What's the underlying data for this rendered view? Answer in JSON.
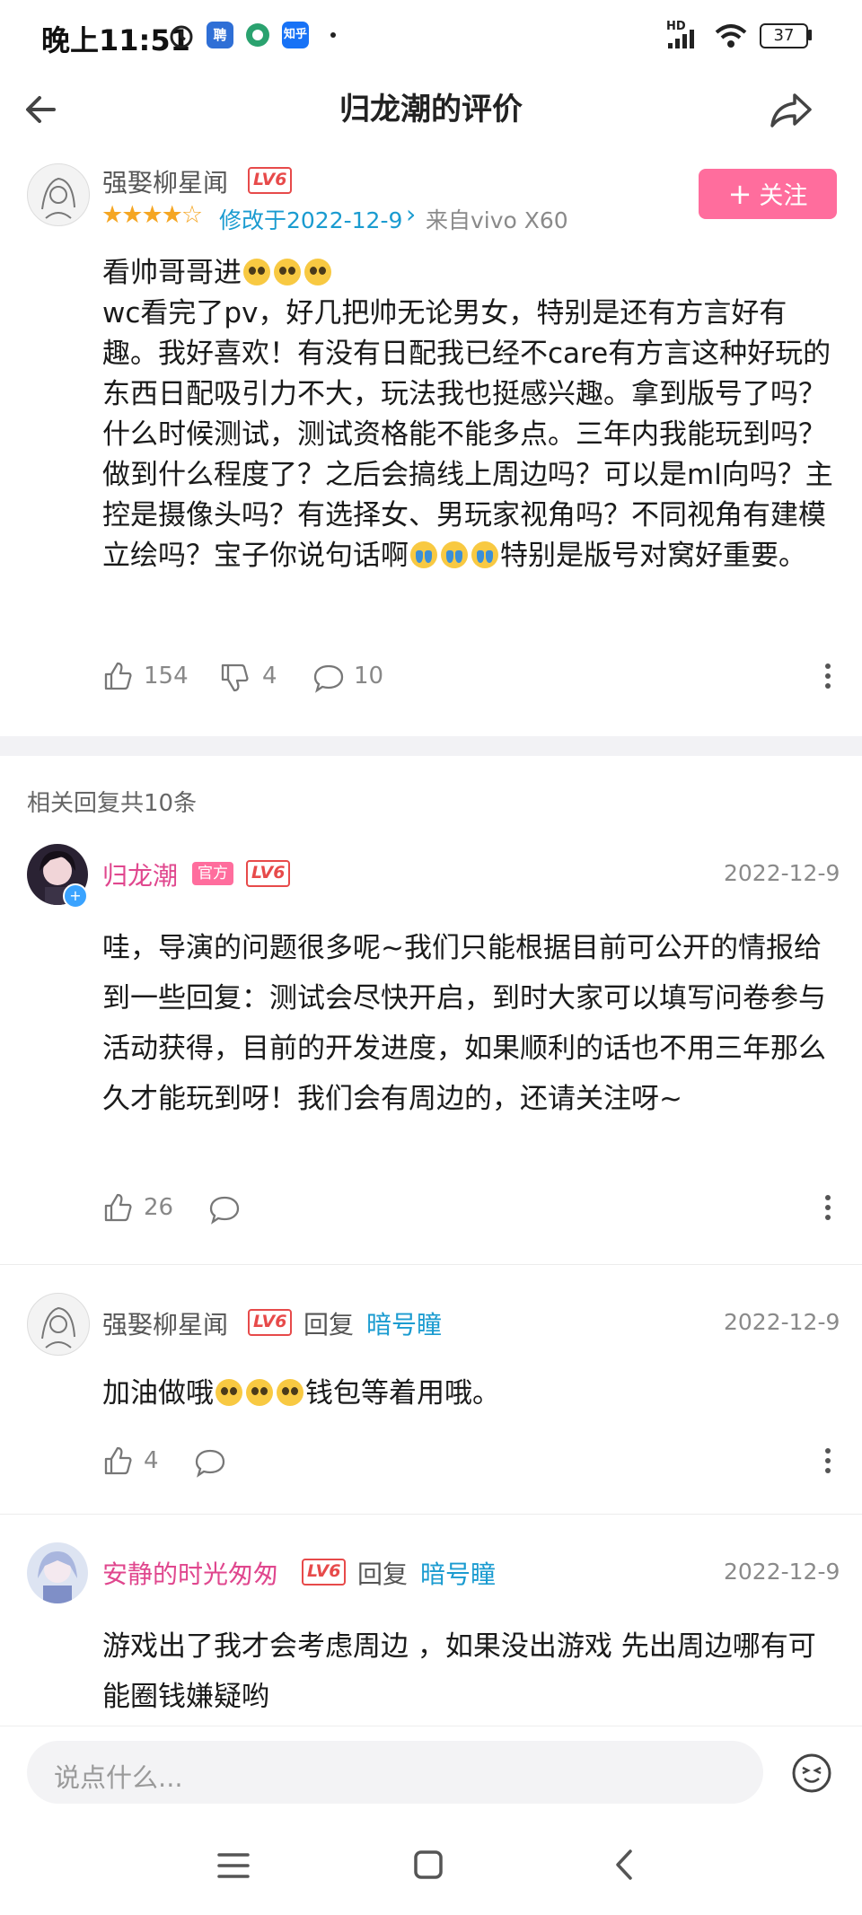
{
  "status_bar": {
    "time": "晚上11:51",
    "apps": [
      "聘",
      "知乎"
    ],
    "network": "HD",
    "battery": "37"
  },
  "header": {
    "title": "归龙潮的评价"
  },
  "review": {
    "author": "强娶柳星闻",
    "level": "LV6",
    "stars": 4,
    "modified": "修改于2022-12-9",
    "device": "来自vivo X60",
    "follow_label": "关注",
    "text_line1": "看帅哥哥进",
    "text_main": "wc看完了pv，好几把帅无论男女，特别是还有方言好有趣。我好喜欢！有没有日配我已经不care有方言这种好玩的东西日配吸引力不大，玩法我也挺感兴趣。拿到版号了吗？什么时候测试，测试资格能不能多点。三年内我能玩到吗？做到什么程度了？之后会搞线上周边吗？可以是ml向吗？主控是摄像头吗？有选择女、男玩家视角吗？不同视角有建模立绘吗？宝子你说句话啊",
    "text_tail": "特别是版号对窝好重要。",
    "likes": "154",
    "dislikes": "4",
    "comments": "10"
  },
  "replies_header": "相关回复共10条",
  "replies": [
    {
      "author": "归龙潮",
      "badge": "官方",
      "level": "LV6",
      "date": "2022-12-9",
      "text": "哇，导演的问题很多呢~我们只能根据目前可公开的情报给到一些回复：测试会尽快开启，到时大家可以填写问卷参与活动获得，目前的开发进度，如果顺利的话也不用三年那么久才能玩到呀！我们会有周边的，还请关注呀~",
      "likes": "26"
    },
    {
      "author": "强娶柳星闻",
      "level": "LV6",
      "reply_word": "回复",
      "reply_to": "暗号瞳",
      "date": "2022-12-9",
      "text_a": "加油做哦",
      "text_b": "钱包等着用哦。",
      "likes": "4"
    },
    {
      "author": "安静的时光匆匆",
      "level": "LV6",
      "reply_word": "回复",
      "reply_to": "暗号瞳",
      "date": "2022-12-9",
      "text": "游戏出了我才会考虑周边 ，如果没出游戏 先出周边哪有可能圈钱嫌疑哟"
    }
  ],
  "input": {
    "placeholder": "说点什么..."
  },
  "colors": {
    "accent_pink": "#ff6d9d",
    "level_red": "#e74a4a",
    "link_blue": "#1a9bd0",
    "star": "#f5a623"
  }
}
